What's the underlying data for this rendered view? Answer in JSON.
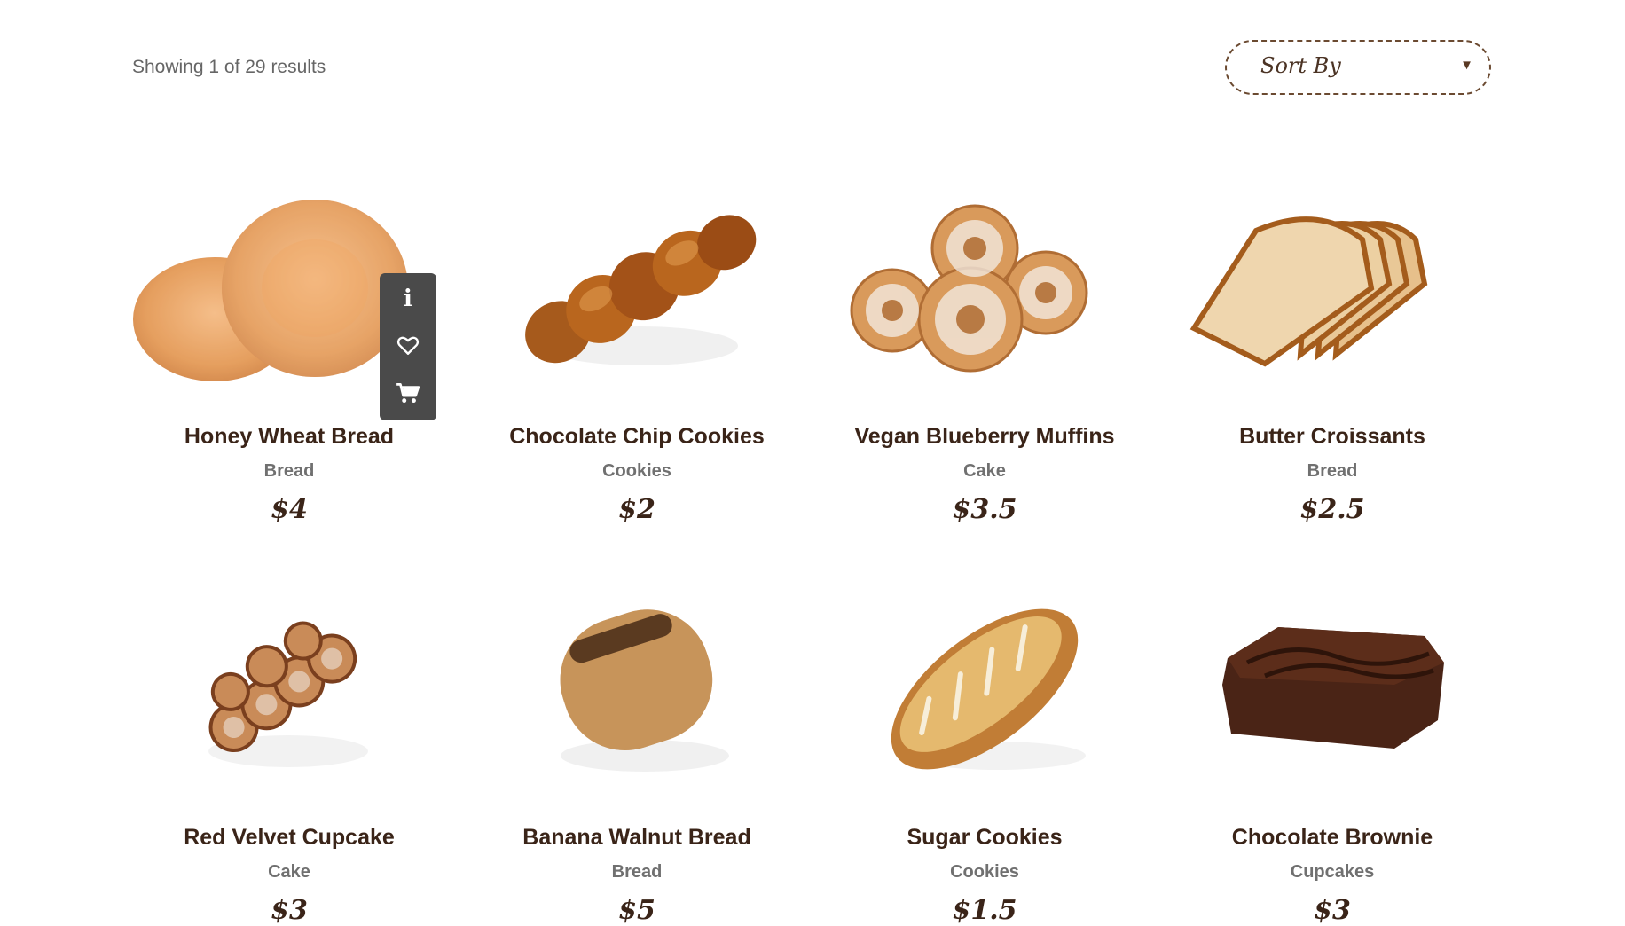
{
  "results_text": "Showing 1 of 29 results",
  "sort": {
    "label": "Sort By",
    "arrow": "▼"
  },
  "actions": {
    "info_icon": "i",
    "wishlist_icon": "heart-icon",
    "cart_icon": "cart-icon"
  },
  "products": [
    {
      "name": "Honey Wheat Bread",
      "category": "Bread",
      "price": "$4",
      "image": "donut-image"
    },
    {
      "name": "Chocolate Chip Cookies",
      "category": "Cookies",
      "price": "$2",
      "image": "braided-bread-image"
    },
    {
      "name": "Vegan Blueberry Muffins",
      "category": "Cake",
      "price": "$3.5",
      "image": "pastry-rings-image"
    },
    {
      "name": "Butter Croissants",
      "category": "Bread",
      "price": "$2.5",
      "image": "sliced-bread-image"
    },
    {
      "name": "Red Velvet Cupcake",
      "category": "Cake",
      "price": "$3",
      "image": "cinnamon-rolls-image"
    },
    {
      "name": "Banana Walnut Bread",
      "category": "Bread",
      "price": "$5",
      "image": "wholegrain-loaf-image"
    },
    {
      "name": "Sugar Cookies",
      "category": "Cookies",
      "price": "$1.5",
      "image": "baguette-loaf-image"
    },
    {
      "name": "Chocolate Brownie",
      "category": "Cupcakes",
      "price": "$3",
      "image": "brownie-image"
    }
  ]
}
